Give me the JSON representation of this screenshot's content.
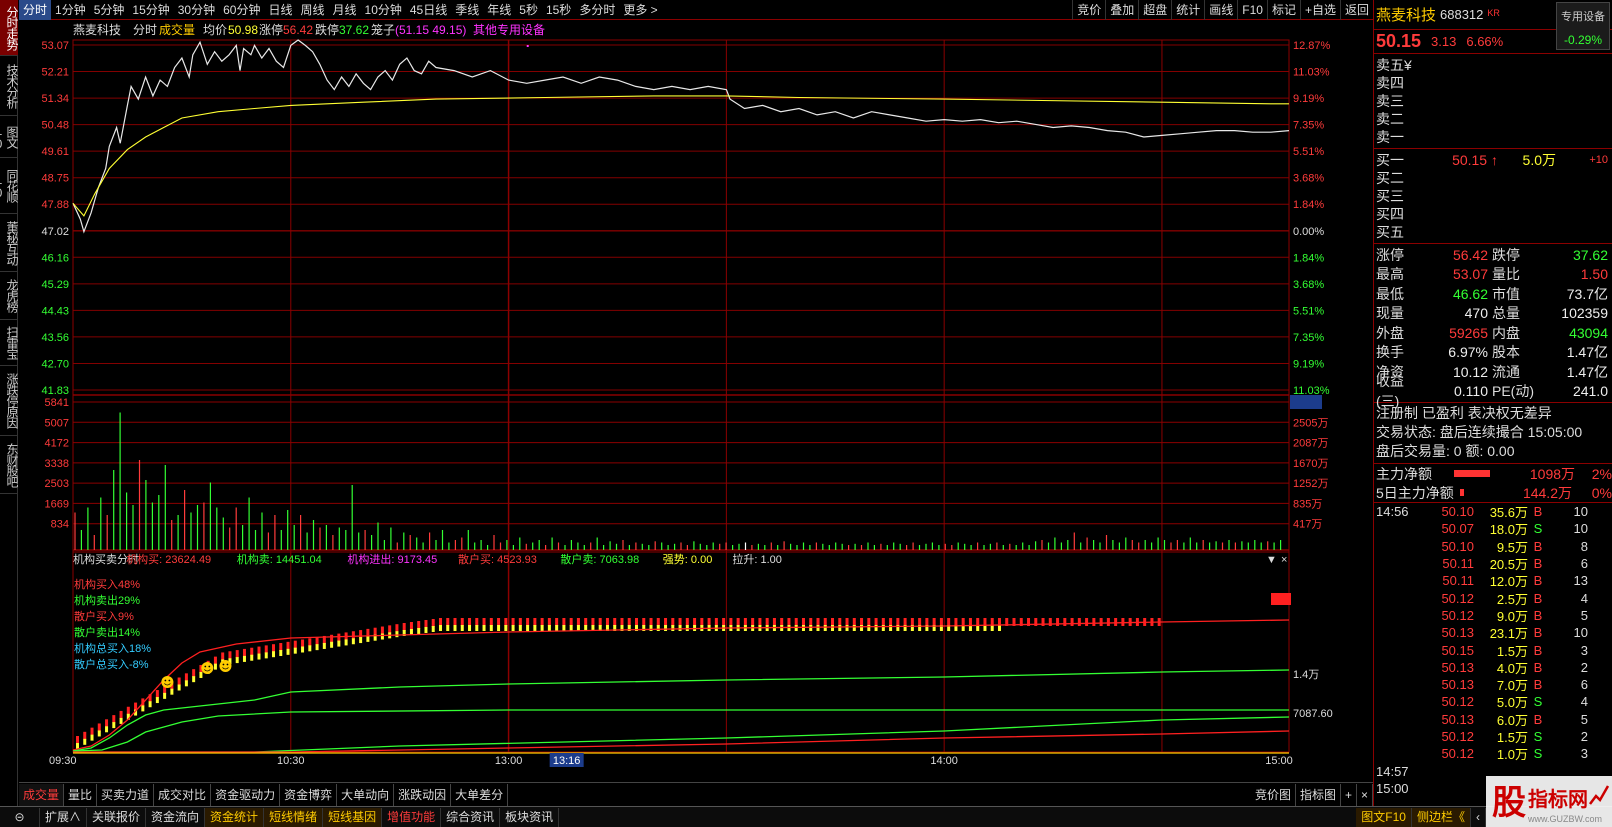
{
  "left_tabs": [
    "分时走势",
    "技术分析",
    "图文10",
    "同花顺10",
    "董秘互动",
    "龙虎榜",
    "扫雷宝",
    "涨跌停原因",
    "东财股吧"
  ],
  "top_bar": {
    "periods": [
      "分时",
      "1分钟",
      "5分钟",
      "15分钟",
      "30分钟",
      "60分钟",
      "日线",
      "周线",
      "月线",
      "10分钟",
      "45日线",
      "季线",
      "年线",
      "5秒",
      "15秒",
      "多分时",
      "更多 >"
    ],
    "tools": [
      "竞价",
      "叠加",
      "超盘",
      "统计",
      "画线",
      "F10",
      "标记",
      "+自选",
      "返回"
    ]
  },
  "chart_header": {
    "name": "燕麦科技",
    "mode": "分时",
    "vol_label": "成交量",
    "avg_label": "均价",
    "avg_value": "50.98",
    "limit_up_label": "涨停",
    "limit_up_value": "56.42",
    "limit_down_label": "跌停",
    "limit_down_value": "37.62",
    "box_label": "笼子",
    "box_value": "(51.15 49.15)",
    "device_label": "其他专用设备"
  },
  "chart_data": {
    "type": "line",
    "title": "燕麦科技 分时",
    "prev_close": 50.15,
    "y_left_ticks": [
      "53.07",
      "52.21",
      "51.34",
      "50.48",
      "49.61",
      "48.75",
      "47.88",
      "47.02",
      "46.16",
      "45.29",
      "44.43",
      "43.56",
      "42.70",
      "41.83"
    ],
    "y_right_ticks": [
      "12.87%",
      "11.03%",
      "9.19%",
      "7.35%",
      "5.51%",
      "3.68%",
      "1.84%",
      "0.00%",
      "1.84%",
      "3.68%",
      "5.51%",
      "7.35%",
      "9.19%",
      "11.03%"
    ],
    "ylim": [
      41.83,
      53.07
    ],
    "x_ticks": [
      "09:30",
      "10:30",
      "13:00",
      "14:00",
      "15:00"
    ],
    "x_cursor": "13:16",
    "price_series": {
      "name": "价格",
      "points": [
        [
          0,
          47.9
        ],
        [
          2,
          47.4
        ],
        [
          3,
          47.0
        ],
        [
          5,
          47.6
        ],
        [
          7,
          48.4
        ],
        [
          9,
          49.0
        ],
        [
          10,
          49.7
        ],
        [
          12,
          50.3
        ],
        [
          13,
          49.8
        ],
        [
          15,
          51.0
        ],
        [
          16,
          51.6
        ],
        [
          18,
          51.2
        ],
        [
          20,
          51.9
        ],
        [
          22,
          51.3
        ],
        [
          24,
          51.8
        ],
        [
          26,
          51.6
        ],
        [
          28,
          52.2
        ],
        [
          30,
          52.5
        ],
        [
          32,
          51.9
        ],
        [
          33,
          52.6
        ],
        [
          35,
          53.0
        ],
        [
          37,
          52.3
        ],
        [
          39,
          52.7
        ],
        [
          41,
          52.4
        ],
        [
          43,
          52.6
        ],
        [
          45,
          52.9
        ],
        [
          46,
          52.1
        ],
        [
          47,
          52.8
        ],
        [
          49,
          52.6
        ],
        [
          50,
          52.9
        ],
        [
          52,
          52.5
        ],
        [
          54,
          52.8
        ],
        [
          56,
          52.4
        ],
        [
          58,
          52.2
        ],
        [
          60,
          52.9
        ],
        [
          62,
          53.07
        ],
        [
          64,
          52.9
        ],
        [
          66,
          52.7
        ],
        [
          68,
          52.3
        ],
        [
          70,
          51.8
        ],
        [
          72,
          51.5
        ],
        [
          74,
          51.9
        ],
        [
          76,
          51.6
        ],
        [
          78,
          52.0
        ],
        [
          80,
          51.7
        ],
        [
          82,
          51.5
        ],
        [
          84,
          51.9
        ],
        [
          86,
          52.1
        ],
        [
          88,
          51.8
        ],
        [
          90,
          52.3
        ],
        [
          92,
          52.5
        ],
        [
          94,
          52.1
        ],
        [
          96,
          52.0
        ],
        [
          98,
          52.4
        ],
        [
          100,
          52.2
        ],
        [
          105,
          52.1
        ],
        [
          110,
          51.9
        ],
        [
          115,
          52.1
        ],
        [
          120,
          51.8
        ],
        [
          125,
          51.7
        ],
        [
          130,
          51.8
        ],
        [
          135,
          51.9
        ],
        [
          140,
          51.7
        ],
        [
          145,
          51.9
        ],
        [
          150,
          51.8
        ],
        [
          155,
          51.6
        ],
        [
          160,
          51.5
        ],
        [
          165,
          51.6
        ],
        [
          170,
          51.5
        ],
        [
          175,
          51.6
        ],
        [
          180,
          51.5
        ],
        [
          181,
          51.2
        ],
        [
          185,
          50.9
        ],
        [
          190,
          51.0
        ],
        [
          195,
          50.8
        ],
        [
          200,
          50.9
        ],
        [
          205,
          50.7
        ],
        [
          210,
          50.8
        ],
        [
          215,
          50.6
        ],
        [
          220,
          50.8
        ],
        [
          225,
          50.7
        ],
        [
          230,
          50.6
        ],
        [
          235,
          50.5
        ],
        [
          240,
          50.55
        ],
        [
          245,
          50.5
        ],
        [
          250,
          50.55
        ],
        [
          255,
          50.45
        ],
        [
          260,
          50.5
        ],
        [
          265,
          50.4
        ],
        [
          270,
          50.3
        ],
        [
          275,
          50.35
        ],
        [
          280,
          50.3
        ],
        [
          285,
          50.2
        ],
        [
          290,
          50.15
        ],
        [
          295,
          50.0
        ],
        [
          300,
          50.05
        ],
        [
          305,
          50.1
        ],
        [
          310,
          50.15
        ],
        [
          315,
          50.2
        ],
        [
          320,
          50.2
        ],
        [
          325,
          50.15
        ],
        [
          330,
          50.15
        ],
        [
          335,
          50.2
        ]
      ]
    },
    "avg_series": {
      "name": "均价",
      "points": [
        [
          0,
          47.9
        ],
        [
          3,
          47.5
        ],
        [
          6,
          48.2
        ],
        [
          10,
          49.0
        ],
        [
          15,
          49.6
        ],
        [
          20,
          50.0
        ],
        [
          25,
          50.3
        ],
        [
          30,
          50.6
        ],
        [
          40,
          50.8
        ],
        [
          50,
          50.9
        ],
        [
          60,
          51.0
        ],
        [
          80,
          51.1
        ],
        [
          100,
          51.2
        ],
        [
          130,
          51.25
        ],
        [
          160,
          51.3
        ],
        [
          180,
          51.3
        ],
        [
          200,
          51.25
        ],
        [
          240,
          51.2
        ],
        [
          300,
          51.1
        ],
        [
          330,
          51.05
        ],
        [
          335,
          51.05
        ]
      ]
    },
    "volume": {
      "y_left_ticks": [
        "5841",
        "5007",
        "4172",
        "3338",
        "2503",
        "1669",
        "834"
      ],
      "y_right_ticks": [
        "5490",
        "2505万",
        "2087万",
        "1670万",
        "1252万",
        "835万",
        "417万"
      ],
      "ymax": 5841,
      "bars": [
        1500,
        800,
        1700,
        600,
        2100,
        1400,
        3200,
        5500,
        2300,
        1800,
        3600,
        2800,
        1900,
        2200,
        3400,
        1200,
        1400,
        2400,
        1500,
        1800,
        1900,
        2700,
        1700,
        1300,
        900,
        1700,
        1000,
        2100,
        800,
        1500,
        700,
        1400,
        800,
        1600,
        1000,
        1400,
        700,
        1200,
        900,
        1000,
        600,
        900,
        800,
        2600,
        700,
        800,
        600,
        1100,
        400,
        900,
        300,
        700,
        600,
        500,
        300,
        700,
        400,
        800,
        300,
        400,
        500,
        800,
        300,
        400,
        200,
        600,
        300,
        400,
        200,
        500,
        250,
        300,
        400,
        200,
        500,
        300,
        200,
        400,
        300,
        200,
        300,
        500,
        200,
        350,
        250,
        400,
        200,
        300,
        250,
        200,
        350,
        300,
        200,
        250,
        300,
        200,
        350,
        250,
        200,
        300,
        250,
        300,
        200,
        250,
        300,
        200,
        250,
        200,
        300,
        200,
        350,
        250,
        200,
        300,
        200,
        300,
        250,
        200,
        300,
        250,
        200,
        250,
        200,
        300,
        200,
        250,
        200,
        300,
        250,
        200,
        300,
        200,
        250,
        300,
        200,
        250,
        200,
        300,
        250,
        200,
        300,
        200,
        250,
        300,
        200,
        250,
        200,
        300,
        200,
        350,
        400,
        300,
        500,
        300,
        400,
        700,
        300,
        500,
        400,
        300,
        600,
        400,
        300,
        500,
        400,
        300,
        400,
        300,
        500,
        400,
        300,
        400,
        300,
        500,
        300,
        400,
        300,
        350,
        300,
        400,
        300,
        350,
        300,
        400,
        300,
        350,
        300,
        400
      ]
    }
  },
  "indicator": {
    "header": [
      {
        "text": "机构买卖分时",
        "color": "#dddddd"
      },
      {
        "text": "机构买: 23624.49",
        "color": "#ff3b3b"
      },
      {
        "text": "机构卖: 14451.04",
        "color": "#3f3"
      },
      {
        "text": "机构进出: 9173.45",
        "color": "#ff33ff"
      },
      {
        "text": "散户买: 4523.93",
        "color": "#ff3b3b"
      },
      {
        "text": "散户卖: 7063.98",
        "color": "#3f3"
      },
      {
        "text": "强势: 0.00",
        "color": "#ffff33"
      },
      {
        "text": "拉升: 1.00",
        "color": "#dddddd"
      }
    ],
    "legend": [
      {
        "text": "机构买入48%",
        "color": "#ff3b3b"
      },
      {
        "text": "机构卖出29%",
        "color": "#3f3"
      },
      {
        "text": "散户买入9%",
        "color": "#ff3b3b"
      },
      {
        "text": "散户卖出14%",
        "color": "#3f3"
      },
      {
        "text": "机构总买入18%",
        "color": "#33ccff"
      },
      {
        "text": "散户总买入-8%",
        "color": "#33ccff"
      }
    ],
    "y_right_ticks": [
      "1.4万",
      "7087.60"
    ],
    "controls": [
      "▼",
      "×"
    ]
  },
  "quote": {
    "name": "燕麦科技",
    "code": "688312",
    "badge": "KR",
    "special": {
      "label": "专用设备",
      "change": "-0.29%"
    },
    "price": "50.15",
    "change": "3.13",
    "change_pct": "6.66%",
    "sell": [
      {
        "label": "卖五",
        "extra": "¥"
      },
      {
        "label": "卖四",
        "extra": ""
      },
      {
        "label": "卖三",
        "extra": ""
      },
      {
        "label": "卖二",
        "extra": ""
      },
      {
        "label": "卖一",
        "extra": ""
      }
    ],
    "buy": [
      {
        "label": "买一",
        "price": "50.15 ↑",
        "vol": "5.0万",
        "chg": "+10"
      },
      {
        "label": "买二",
        "price": "",
        "vol": "",
        "chg": ""
      },
      {
        "label": "买三",
        "price": "",
        "vol": "",
        "chg": ""
      },
      {
        "label": "买四",
        "price": "",
        "vol": "",
        "chg": ""
      },
      {
        "label": "买五",
        "price": "",
        "vol": "",
        "chg": ""
      }
    ],
    "stats": [
      {
        "k": "涨停",
        "v": "56.42",
        "vc": "red",
        "k2": "跌停",
        "v2": "37.62",
        "v2c": "green"
      },
      {
        "k": "最高",
        "v": "53.07",
        "vc": "red",
        "k2": "量比",
        "v2": "1.50",
        "v2c": "red"
      },
      {
        "k": "最低",
        "v": "46.62",
        "vc": "green",
        "k2": "市值",
        "v2": "73.7亿",
        "v2c": "white"
      },
      {
        "k": "现量",
        "v": "470",
        "vc": "white",
        "k2": "总量",
        "v2": "102359",
        "v2c": "white"
      },
      {
        "k": "外盘",
        "v": "59265",
        "vc": "red",
        "k2": "内盘",
        "v2": "43094",
        "v2c": "green"
      },
      {
        "k": "换手",
        "v": "6.97%",
        "vc": "white",
        "k2": "股本",
        "v2": "1.47亿",
        "v2c": "white"
      },
      {
        "k": "净资",
        "v": "10.12",
        "vc": "white",
        "k2": "流通",
        "v2": "1.47亿",
        "v2c": "white"
      },
      {
        "k": "收益(三)",
        "v": "0.110",
        "vc": "white",
        "k2": "PE(动)",
        "v2": "241.0",
        "v2c": "white"
      }
    ],
    "info": [
      "注册制 已盈利 表决权无差异",
      "交易状态: 盘后连续撮合 15:05:00",
      "盘后交易量: 0  额: 0.00"
    ],
    "flows": [
      {
        "k": "主力净额",
        "v": "1098万",
        "pct": "2%",
        "bar": 0.55
      },
      {
        "k": "5日主力净额",
        "v": "144.2万",
        "pct": "0%",
        "bar": 0.06
      }
    ],
    "ticks": [
      {
        "t": "14:56",
        "p": "50.10",
        "v": "35.6万",
        "s": "B",
        "n": "10"
      },
      {
        "t": "",
        "p": "50.07",
        "v": "18.0万",
        "s": "S",
        "n": "10"
      },
      {
        "t": "",
        "p": "50.10",
        "v": "9.5万",
        "s": "B",
        "n": "8"
      },
      {
        "t": "",
        "p": "50.11",
        "v": "20.5万",
        "s": "B",
        "n": "6"
      },
      {
        "t": "",
        "p": "50.11",
        "v": "12.0万",
        "s": "B",
        "n": "13"
      },
      {
        "t": "",
        "p": "50.12",
        "v": "2.5万",
        "s": "B",
        "n": "4"
      },
      {
        "t": "",
        "p": "50.12",
        "v": "9.0万",
        "s": "B",
        "n": "5"
      },
      {
        "t": "",
        "p": "50.13",
        "v": "23.1万",
        "s": "B",
        "n": "10"
      },
      {
        "t": "",
        "p": "50.15",
        "v": "1.5万",
        "s": "B",
        "n": "3"
      },
      {
        "t": "",
        "p": "50.13",
        "v": "4.0万",
        "s": "B",
        "n": "2"
      },
      {
        "t": "",
        "p": "50.13",
        "v": "7.0万",
        "s": "B",
        "n": "6"
      },
      {
        "t": "",
        "p": "50.12",
        "v": "5.0万",
        "s": "S",
        "n": "4"
      },
      {
        "t": "",
        "p": "50.13",
        "v": "6.0万",
        "s": "B",
        "n": "5"
      },
      {
        "t": "",
        "p": "50.12",
        "v": "1.5万",
        "s": "S",
        "n": "2"
      },
      {
        "t": "",
        "p": "50.12",
        "v": "1.0万",
        "s": "S",
        "n": "3"
      },
      {
        "t": "14:57",
        "p": "",
        "v": "",
        "s": "",
        "n": ""
      },
      {
        "t": "15:00",
        "p": "",
        "v": "",
        "s": "",
        "n": ""
      }
    ]
  },
  "bottom_tabs": {
    "items": [
      "成交量",
      "量比",
      "买卖力道",
      "成交对比",
      "资金驱动力",
      "资金博弈",
      "大单动向",
      "涨跌动因",
      "大单差分"
    ],
    "right": [
      "竞价图",
      "指标图",
      "+",
      "×"
    ]
  },
  "status_bar": {
    "left": [
      "扩展∧",
      "关联报价",
      "资金流向",
      "资金统计",
      "短线情绪",
      "短线基因",
      "增值功能",
      "综合资讯",
      "板块资讯"
    ],
    "right": [
      "图文F10",
      "侧边栏《",
      "‹"
    ]
  },
  "watermark": {
    "text1": "股",
    "text2": "指标网",
    "url": "www.GUZBW.com"
  }
}
